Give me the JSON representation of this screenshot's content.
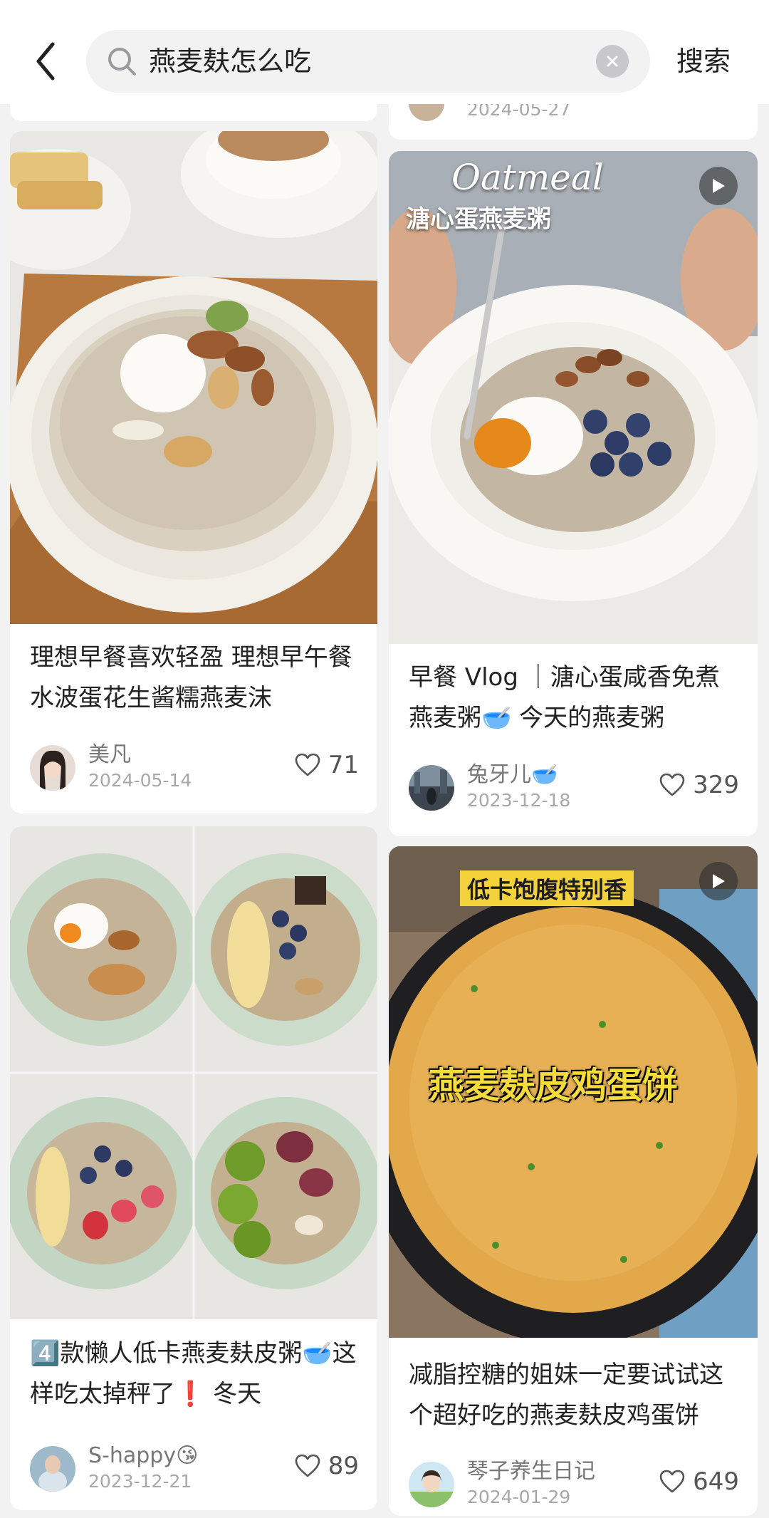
{
  "search": {
    "query": "燕麦麸怎么吃",
    "submit_label": "搜索"
  },
  "partial_card": {
    "date": "2024-05-27"
  },
  "cards": [
    {
      "title": "理想早餐喜欢轻盈 理想早午餐水波蛋花生酱糯燕麦沫",
      "author": "美凡",
      "date": "2024-05-14",
      "likes": "71"
    },
    {
      "overlay_title": "Oatmeal",
      "overlay_subtitle": "溏心蛋燕麦粥",
      "title": "早餐 Vlog ｜溏心蛋咸香免煮燕麦粥🥣 今天的燕麦粥",
      "author": "兔牙儿🥣",
      "date": "2023-12-18",
      "likes": "329"
    },
    {
      "title": "4️⃣款懒人低卡燕麦麸皮粥🥣这样吃太掉秤了❗️ 冬天",
      "author": "S-happy😘",
      "date": "2023-12-21",
      "likes": "89"
    },
    {
      "overlay_top": "低卡饱腹特别香",
      "overlay_center": "燕麦麸皮鸡蛋饼",
      "title": "减脂控糖的姐妹一定要试试这个超好吃的燕麦麸皮鸡蛋饼",
      "author": "琴子养生日记",
      "date": "2024-01-29",
      "likes": "649"
    }
  ],
  "icons": {
    "back": "chevron-left-icon",
    "search": "search-icon",
    "clear": "close-circle-icon",
    "like": "heart-outline-icon",
    "play": "play-icon"
  },
  "colors": {
    "background": "#f2f2f2",
    "card": "#ffffff",
    "text": "#222222",
    "muted": "#a8a8a8"
  }
}
